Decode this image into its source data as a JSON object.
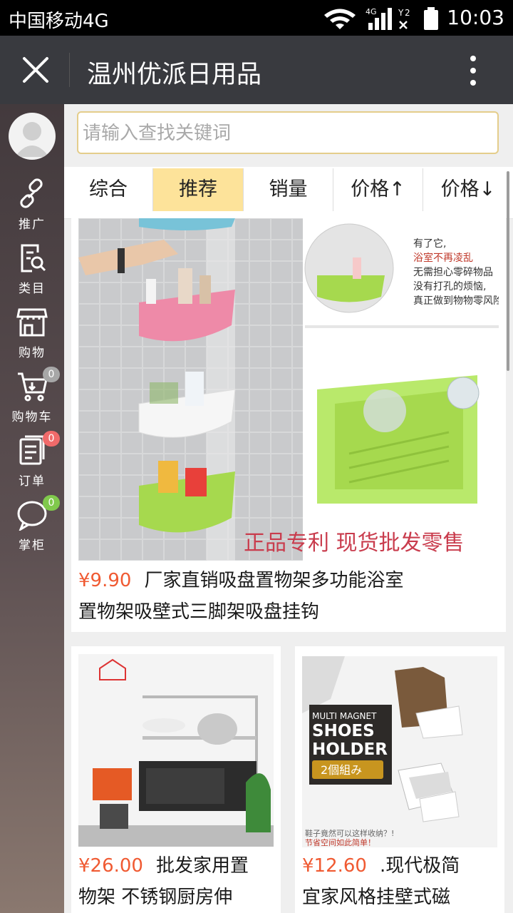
{
  "status_bar": {
    "carrier": "中国移动4G",
    "time": "10:03",
    "network_label": "4G",
    "sim_label": "2"
  },
  "title_bar": {
    "title": "温州优派日用品"
  },
  "sidebar": {
    "items": [
      {
        "label": "推广",
        "icon": "link-icon"
      },
      {
        "label": "类目",
        "icon": "category-search-icon"
      },
      {
        "label": "购物",
        "icon": "shop-icon"
      },
      {
        "label": "购物车",
        "icon": "cart-icon",
        "badge": "0"
      },
      {
        "label": "订单",
        "icon": "order-icon",
        "badge": "0"
      },
      {
        "label": "掌柜",
        "icon": "chat-icon",
        "badge": "0"
      }
    ]
  },
  "search": {
    "placeholder": "请输入查找关键词"
  },
  "tabs": [
    "综合",
    "推荐",
    "销量",
    "价格↑",
    "价格↓"
  ],
  "active_tab": "推荐",
  "products": [
    {
      "price": "¥9.90",
      "title_line1": "厂家直销吸盘置物架多功能浴室",
      "title_line2": "置物架吸壁式三脚架吸盘挂钩",
      "image_text": "正品专利 现货批发零售"
    },
    {
      "price": "¥26.00",
      "title_line1": "批发家用置",
      "title_line2": "物架 不锈钢厨房伸"
    },
    {
      "price": "¥12.60",
      "title_line1": ".现代极简",
      "title_line2": "宜家风格挂壁式磁",
      "image_text_1": "MULTI MAGNET",
      "image_text_2": "SHOES",
      "image_text_3": "HOLDER",
      "image_text_4": "2個組み"
    }
  ],
  "colors": {
    "accent_price": "#f05a32",
    "active_tab_bg": "#fde39a",
    "titlebar_bg": "#393a3f",
    "search_border": "#e4cd8b"
  }
}
